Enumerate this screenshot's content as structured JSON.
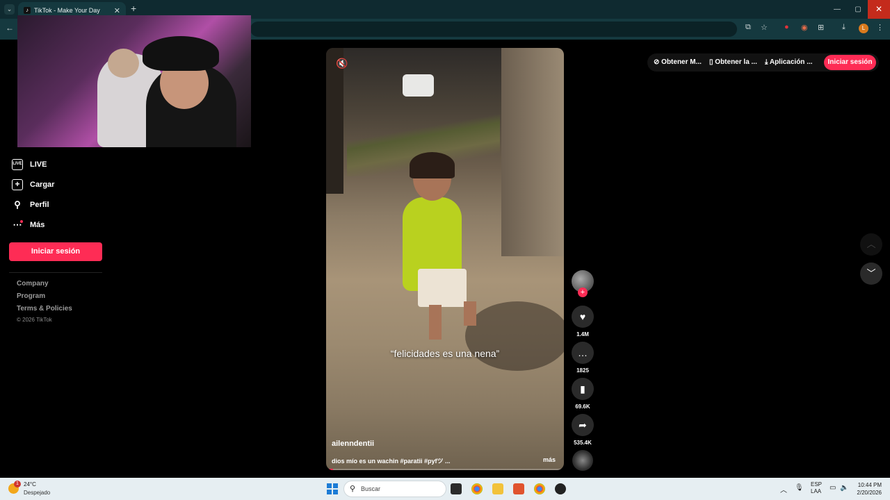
{
  "browser": {
    "tab_title": "TikTok - Make Your Day",
    "tab_close": "✕",
    "new_tab": "+",
    "tab_list": "⌄",
    "window": {
      "minimize": "—",
      "restore": "▢",
      "close": "✕"
    },
    "back": "←",
    "profile_initial": "L"
  },
  "sidebar": {
    "items": [
      {
        "label": "LIVE",
        "icon": "live-icon"
      },
      {
        "label": "Cargar",
        "icon": "upload-icon"
      },
      {
        "label": "Perfil",
        "icon": "profile-icon"
      },
      {
        "label": "Más",
        "icon": "more-icon"
      }
    ],
    "login_button": "Iniciar sesión",
    "footer_links": [
      "Company",
      "Program",
      "Terms & Policies"
    ],
    "copyright": "© 2026 TikTok"
  },
  "video": {
    "caption_overlay": "“felicidades es una nena”",
    "author": "ailenndentii",
    "description": "dios mío es un wachin #paratii #pyfツ ...",
    "more_label": "más",
    "progress": 0.03
  },
  "actions": {
    "likes": "1.4M",
    "comments": "1825",
    "saves": "69.6K",
    "shares": "535.4K"
  },
  "top_actions": {
    "get_coins": "Obtener M...",
    "get_app": "Obtener la ...",
    "desktop_app": "Aplicación ...",
    "login": "Iniciar sesión"
  },
  "taskbar": {
    "weather_temp": "24°C",
    "weather_cond": "Despejado",
    "weather_badge": "1",
    "search_placeholder": "Buscar",
    "lang_line1": "ESP",
    "lang_line2": "LAA",
    "time": "10:44 PM",
    "date": "2/20/2026"
  },
  "colors": {
    "accent": "#fe2c55",
    "browser_frame": "#0f2a30",
    "taskbar": "#e6eef2"
  }
}
